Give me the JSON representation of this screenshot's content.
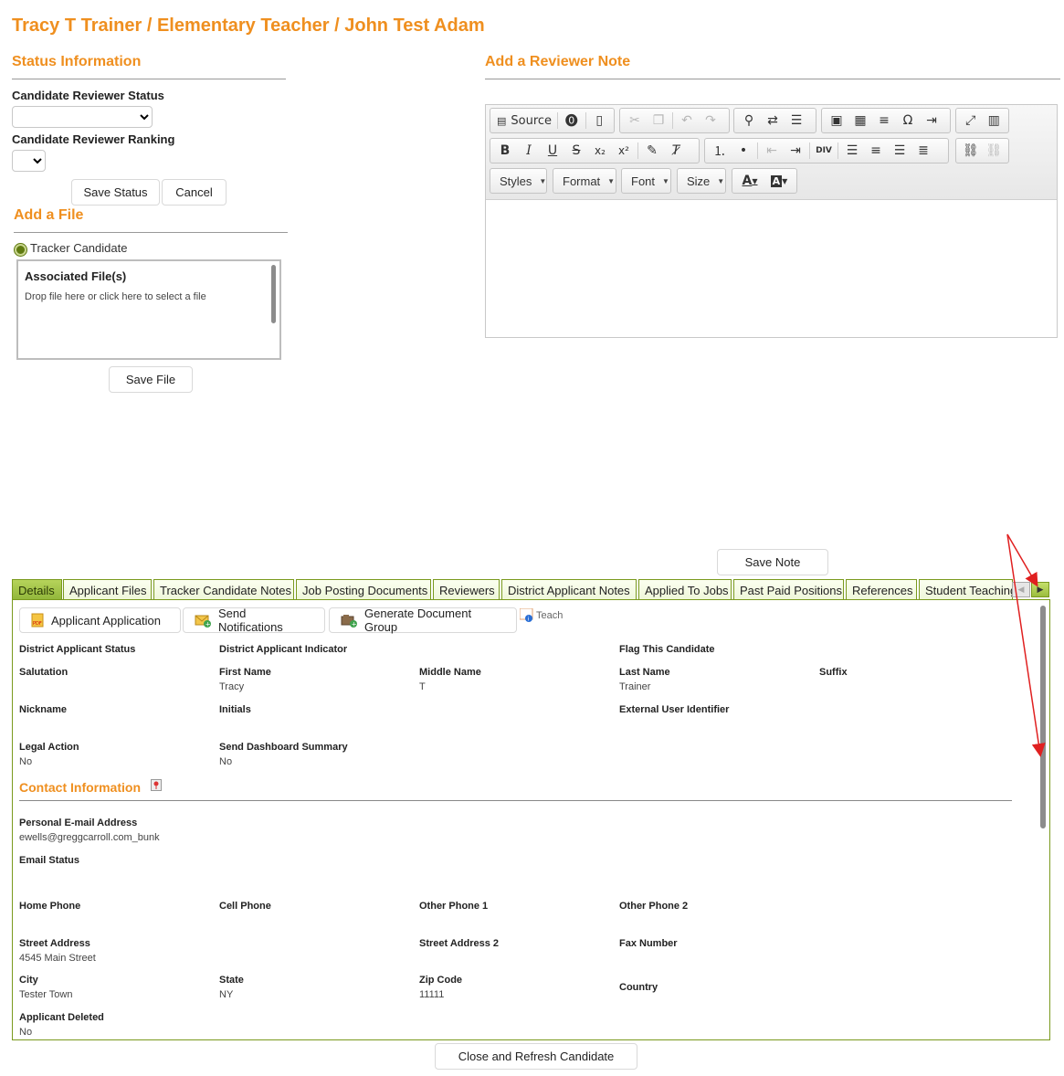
{
  "page_title": "Tracy T Trainer / Elementary Teacher / John Test Adam",
  "status_section": {
    "title": "Status Information",
    "reviewer_status_label": "Candidate Reviewer Status",
    "reviewer_status_value": "",
    "reviewer_ranking_label": "Candidate Reviewer Ranking",
    "reviewer_ranking_value": "",
    "save_status_label": "Save Status",
    "cancel_label": "Cancel"
  },
  "file_section": {
    "title": "Add a File",
    "radio_label": "Tracker Candidate",
    "dropzone_title": "Associated File(s)",
    "dropzone_hint": "Drop file here or click here to select a file",
    "save_file_label": "Save File"
  },
  "note_section": {
    "title": "Add a Reviewer Note",
    "source_label": "Source",
    "styles_label": "Styles",
    "format_label": "Format",
    "font_label": "Font",
    "size_label": "Size",
    "save_note_label": "Save Note"
  },
  "tabs": [
    {
      "label": "Details",
      "active": true
    },
    {
      "label": "Applicant Files",
      "active": false
    },
    {
      "label": "Tracker Candidate Notes",
      "active": false
    },
    {
      "label": "Job Posting Documents",
      "active": false
    },
    {
      "label": "Reviewers",
      "active": false
    },
    {
      "label": "District Applicant Notes",
      "active": false
    },
    {
      "label": "Applied To Jobs",
      "active": false
    },
    {
      "label": "Past Paid Positions",
      "active": false
    },
    {
      "label": "References",
      "active": false
    },
    {
      "label": "Student Teaching",
      "active": false
    }
  ],
  "details": {
    "buttons": {
      "applicant_application": "Applicant Application",
      "send_notifications": "Send Notifications",
      "generate_document_group": "Generate Document Group",
      "teach": "Teach"
    },
    "fields": {
      "district_applicant_status": {
        "label": "District Applicant Status",
        "value": ""
      },
      "district_applicant_indicator": {
        "label": "District Applicant Indicator",
        "value": ""
      },
      "flag_this_candidate": {
        "label": "Flag This Candidate",
        "value": ""
      },
      "salutation": {
        "label": "Salutation",
        "value": ""
      },
      "first_name": {
        "label": "First Name",
        "value": "Tracy"
      },
      "middle_name": {
        "label": "Middle Name",
        "value": "T"
      },
      "last_name": {
        "label": "Last Name",
        "value": "Trainer"
      },
      "suffix": {
        "label": "Suffix",
        "value": ""
      },
      "nickname": {
        "label": "Nickname",
        "value": ""
      },
      "initials": {
        "label": "Initials",
        "value": ""
      },
      "external_user_identifier": {
        "label": "External User Identifier",
        "value": ""
      },
      "legal_action": {
        "label": "Legal Action",
        "value": "No"
      },
      "send_dashboard_summary": {
        "label": "Send Dashboard Summary",
        "value": "No"
      }
    },
    "contact_title": "Contact Information",
    "contact": {
      "personal_email": {
        "label": "Personal E-mail Address",
        "value": "ewells@greggcarroll.com_bunk"
      },
      "email_status": {
        "label": "Email Status",
        "value": ""
      },
      "home_phone": {
        "label": "Home Phone",
        "value": ""
      },
      "cell_phone": {
        "label": "Cell Phone",
        "value": ""
      },
      "other_phone_1": {
        "label": "Other Phone 1",
        "value": ""
      },
      "other_phone_2": {
        "label": "Other Phone 2",
        "value": ""
      },
      "street_address": {
        "label": "Street Address",
        "value": "4545 Main Street"
      },
      "street_address_2": {
        "label": "Street Address 2",
        "value": ""
      },
      "fax_number": {
        "label": "Fax Number",
        "value": ""
      },
      "city": {
        "label": "City",
        "value": "Tester Town"
      },
      "state": {
        "label": "State",
        "value": "NY"
      },
      "zip_code": {
        "label": "Zip Code",
        "value": "11111"
      },
      "country": {
        "label": "Country",
        "value": ""
      },
      "applicant_deleted": {
        "label": "Applicant Deleted",
        "value": "No"
      }
    }
  },
  "close_refresh_label": "Close and Refresh Candidate",
  "colors": {
    "accent": "#ef8f1f",
    "tab_green": "#91b63a",
    "tab_border": "#7a9a1e",
    "annotation_red": "#e02020"
  }
}
